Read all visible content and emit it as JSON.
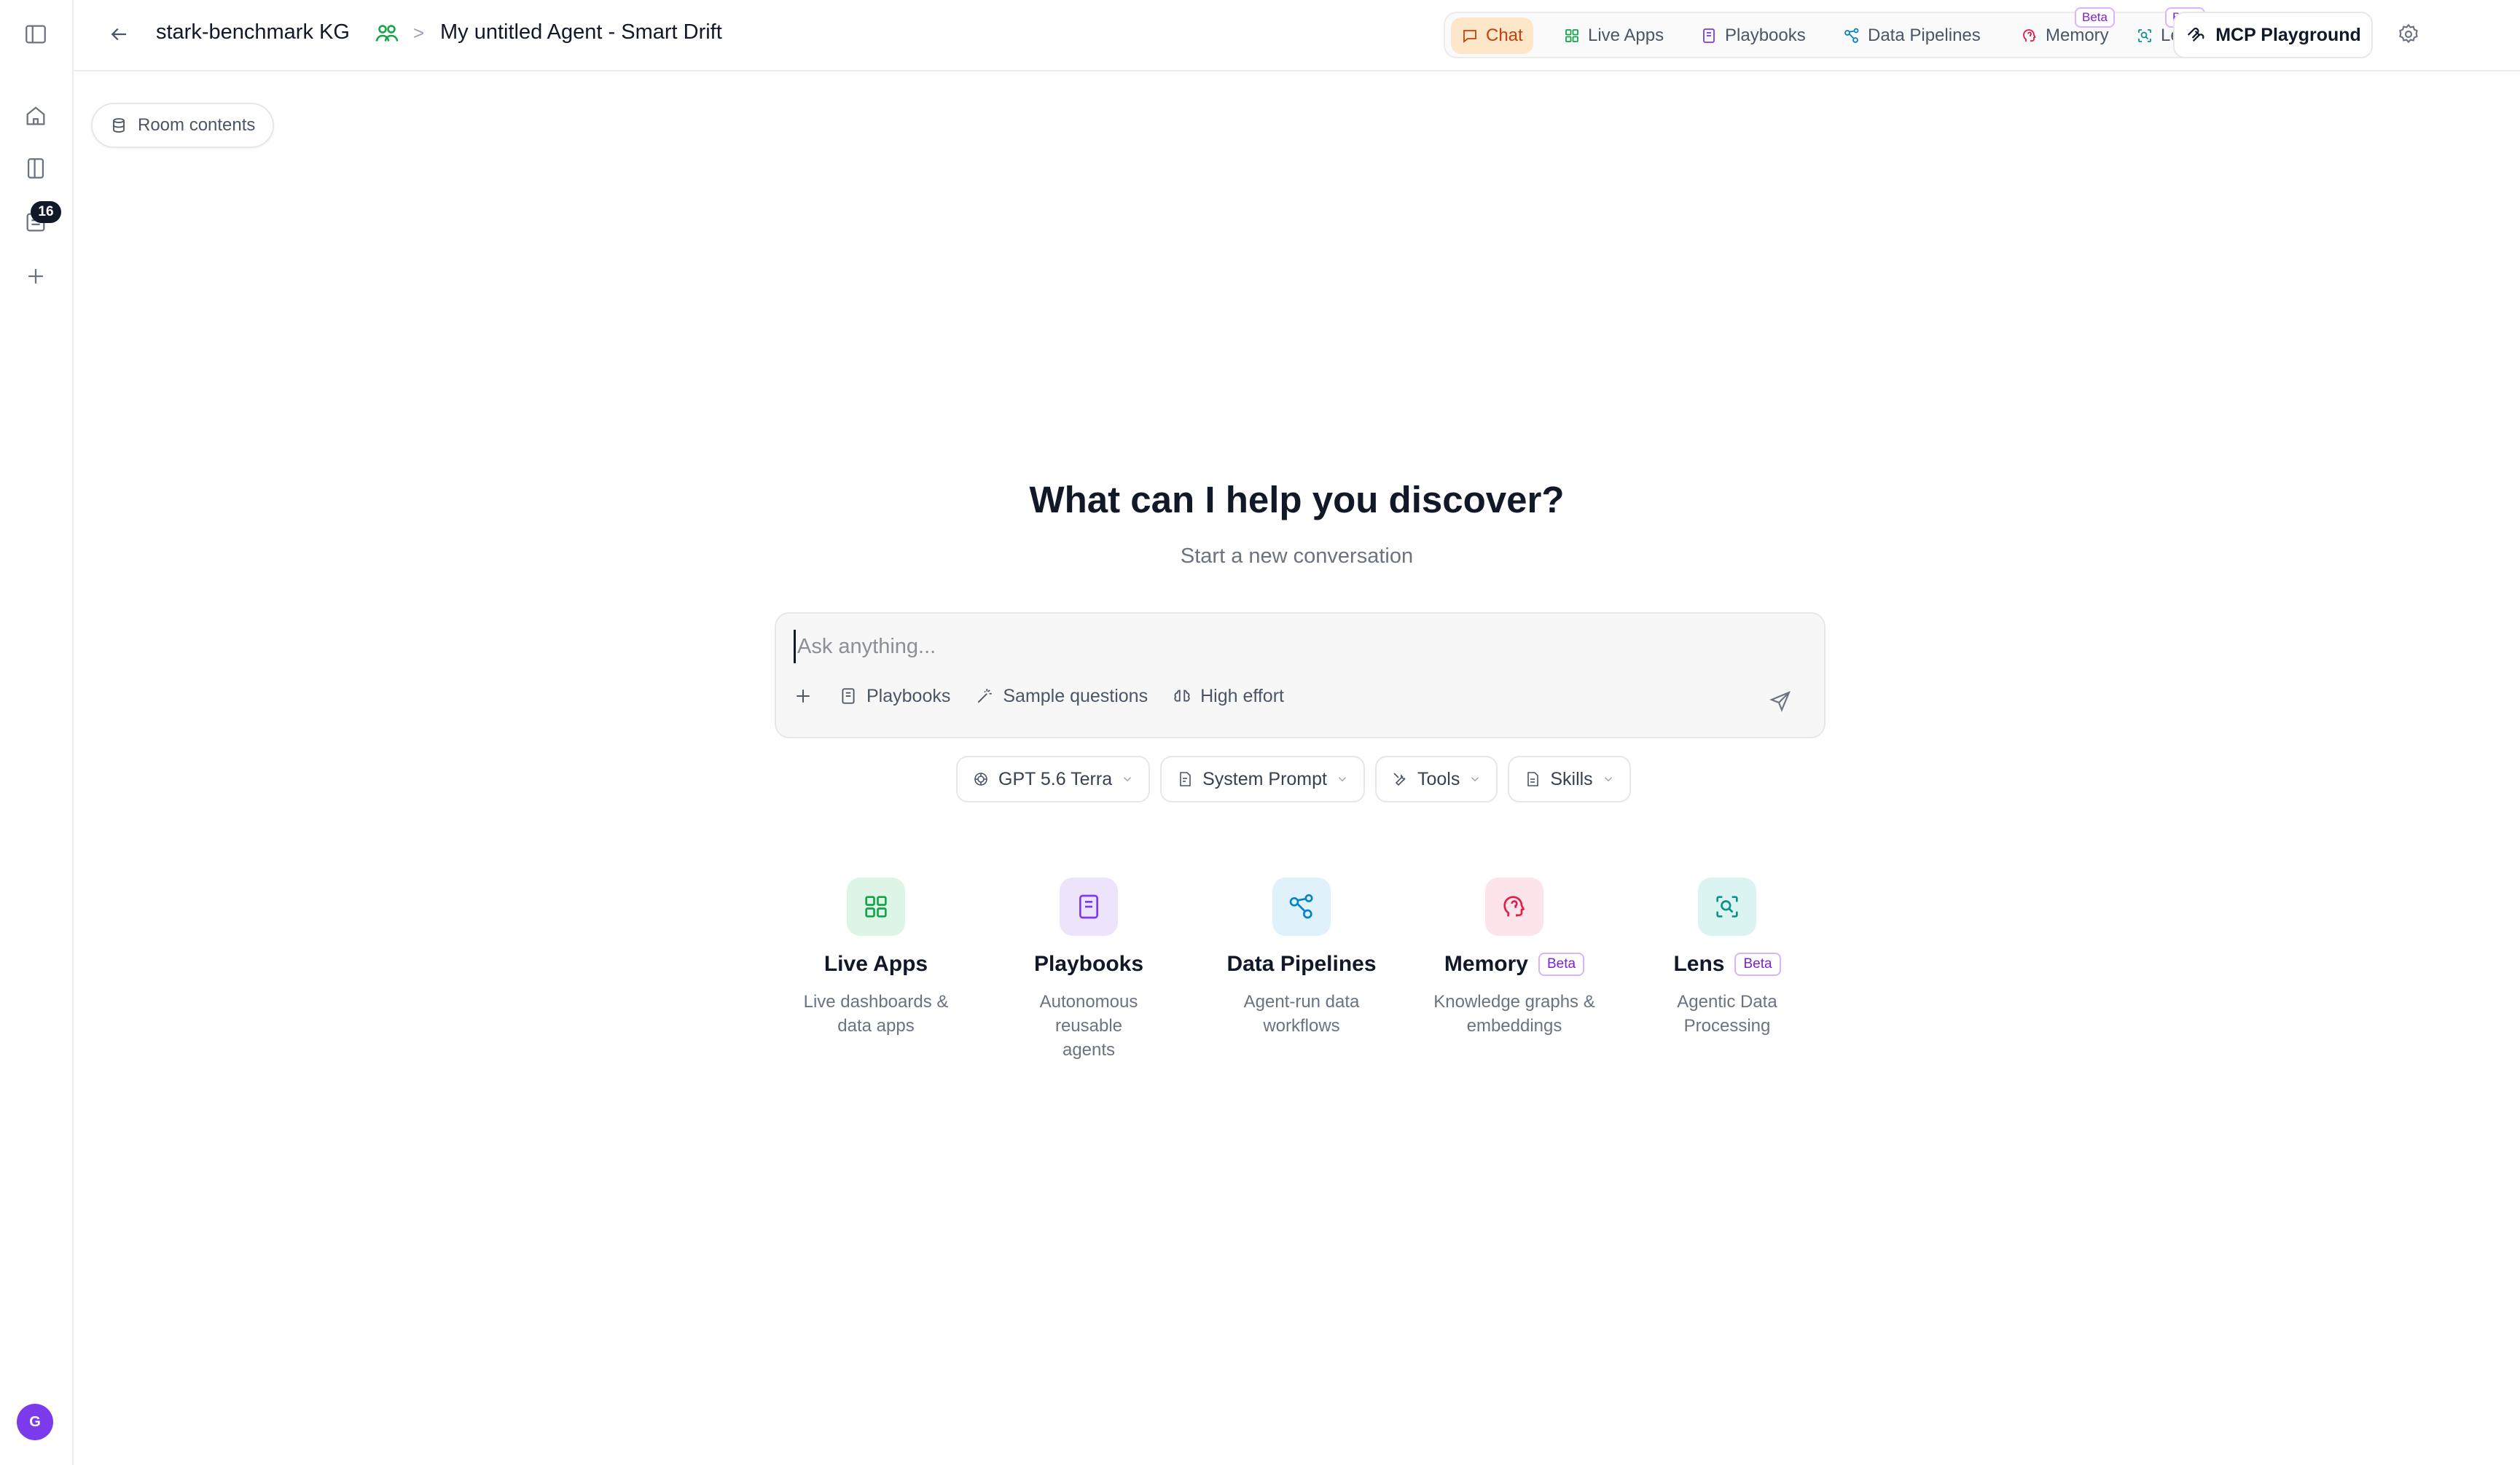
{
  "breadcrumb": {
    "room": "stark-benchmark KG",
    "separator": ">",
    "agent": "My untitled Agent - Smart Drift"
  },
  "nav": {
    "tabs": [
      {
        "label": "Chat",
        "icon": "chat-icon",
        "active": true
      },
      {
        "label": "Live Apps",
        "icon": "grid-icon"
      },
      {
        "label": "Playbooks",
        "icon": "book-icon"
      },
      {
        "label": "Data Pipelines",
        "icon": "share-nodes-icon"
      },
      {
        "label": "Memory",
        "icon": "head-icon",
        "badge": "Beta"
      },
      {
        "label": "Lens",
        "icon": "scan-search-icon",
        "badge": "Beta"
      }
    ],
    "mcp_label": "MCP Playground"
  },
  "sidebar": {
    "badge_count": "16",
    "avatar_initial": "G"
  },
  "room_contents_label": "Room contents",
  "hero": {
    "title": "What can I help you discover?",
    "subtitle": "Start a new conversation"
  },
  "composer": {
    "placeholder": "Ask anything...",
    "tools": {
      "playbooks": "Playbooks",
      "sample_questions": "Sample questions",
      "effort": "High effort"
    }
  },
  "selectors": {
    "model": "GPT 5.6 Terra",
    "system_prompt": "System Prompt",
    "tools": "Tools",
    "skills": "Skills"
  },
  "features": [
    {
      "title": "Live Apps",
      "desc_line1": "Live dashboards &",
      "desc_line2": "data apps",
      "color": "#16a34a",
      "bg": "#dcf5e6"
    },
    {
      "title": "Playbooks",
      "desc_line1": "Autonomous reusable",
      "desc_line2": "agents",
      "color": "#7c3aed",
      "bg": "#ede4fb"
    },
    {
      "title": "Data Pipelines",
      "desc_line1": "Agent-run data",
      "desc_line2": "workflows",
      "color": "#0284c7",
      "bg": "#dff1fb"
    },
    {
      "title": "Memory",
      "badge": "Beta",
      "desc_line1": "Knowledge graphs &",
      "desc_line2": "embeddings",
      "color": "#e11d48",
      "bg": "#fde4ea"
    },
    {
      "title": "Lens",
      "badge": "Beta",
      "desc_line1": "Agentic Data",
      "desc_line2": "Processing",
      "color": "#0d9488",
      "bg": "#dcf4f1"
    }
  ],
  "colors": {
    "accent_orange": "#c2410c",
    "active_tab_bg": "#fde7c8",
    "beta_purple": "#7e22ce",
    "avatar": "#7c3aed"
  }
}
